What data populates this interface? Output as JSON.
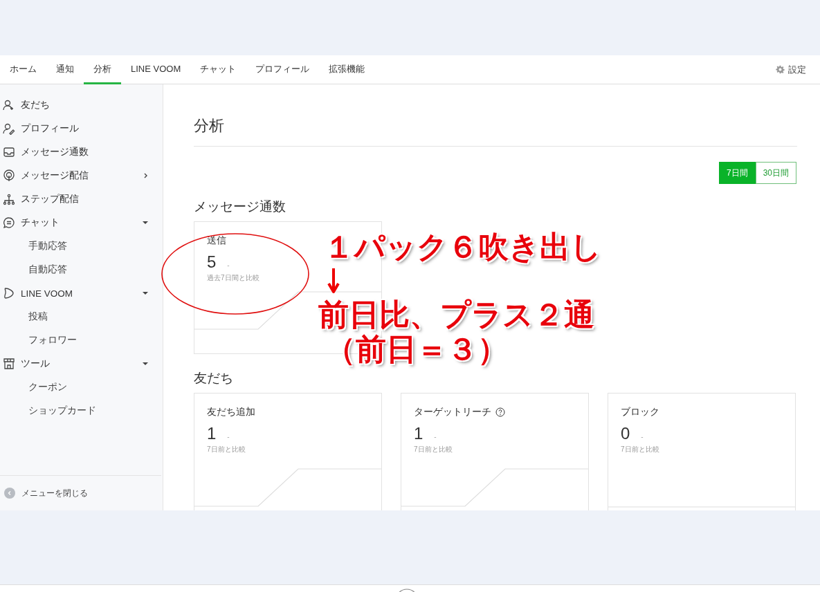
{
  "nav": {
    "tabs": [
      {
        "label": "ホーム",
        "selected": false
      },
      {
        "label": "通知",
        "selected": false
      },
      {
        "label": "分析",
        "selected": true
      },
      {
        "label": "LINE VOOM",
        "selected": false
      },
      {
        "label": "チャット",
        "selected": false
      },
      {
        "label": "プロフィール",
        "selected": false
      },
      {
        "label": "拡張機能",
        "selected": false
      }
    ],
    "settings": "設定"
  },
  "sidebar": {
    "items": [
      {
        "label": "友だち"
      },
      {
        "label": "プロフィール"
      },
      {
        "label": "メッセージ通数"
      },
      {
        "label": "メッセージ配信",
        "expanded": false
      },
      {
        "label": "ステップ配信"
      },
      {
        "label": "チャット",
        "expanded": true,
        "children": [
          {
            "label": "手動応答"
          },
          {
            "label": "自動応答"
          }
        ]
      },
      {
        "label": "LINE VOOM",
        "expanded": true,
        "children": [
          {
            "label": "投稿"
          },
          {
            "label": "フォロワー"
          }
        ]
      },
      {
        "label": "ツール",
        "expanded": true,
        "children": [
          {
            "label": "クーポン"
          },
          {
            "label": "ショップカード"
          }
        ]
      }
    ],
    "close_menu": "メニューを閉じる"
  },
  "page_title": "分析",
  "periods": [
    {
      "label": "7日間",
      "selected": true
    },
    {
      "label": "30日間",
      "selected": false
    }
  ],
  "sections": [
    {
      "title": "メッセージ通数",
      "cards": [
        {
          "label": "送信",
          "help": false,
          "value": "5",
          "delta": "-",
          "compare": "過去7日間と比較",
          "kind": "rising"
        }
      ]
    },
    {
      "title": "友だち",
      "cards": [
        {
          "label": "友だち追加",
          "help": false,
          "value": "1",
          "delta": "-",
          "compare": "7日前と比較",
          "kind": "rising"
        },
        {
          "label": "ターゲットリーチ",
          "help": true,
          "value": "1",
          "delta": "-",
          "compare": "7日前と比較",
          "kind": "rising"
        },
        {
          "label": "ブロック",
          "help": false,
          "value": "0",
          "delta": "-",
          "compare": "7日前と比較",
          "kind": "flat"
        }
      ]
    }
  ],
  "annotation": {
    "lines": [
      "１パック６吹き出し",
      "前日比、プラス２通",
      "（前日＝３）"
    ]
  }
}
